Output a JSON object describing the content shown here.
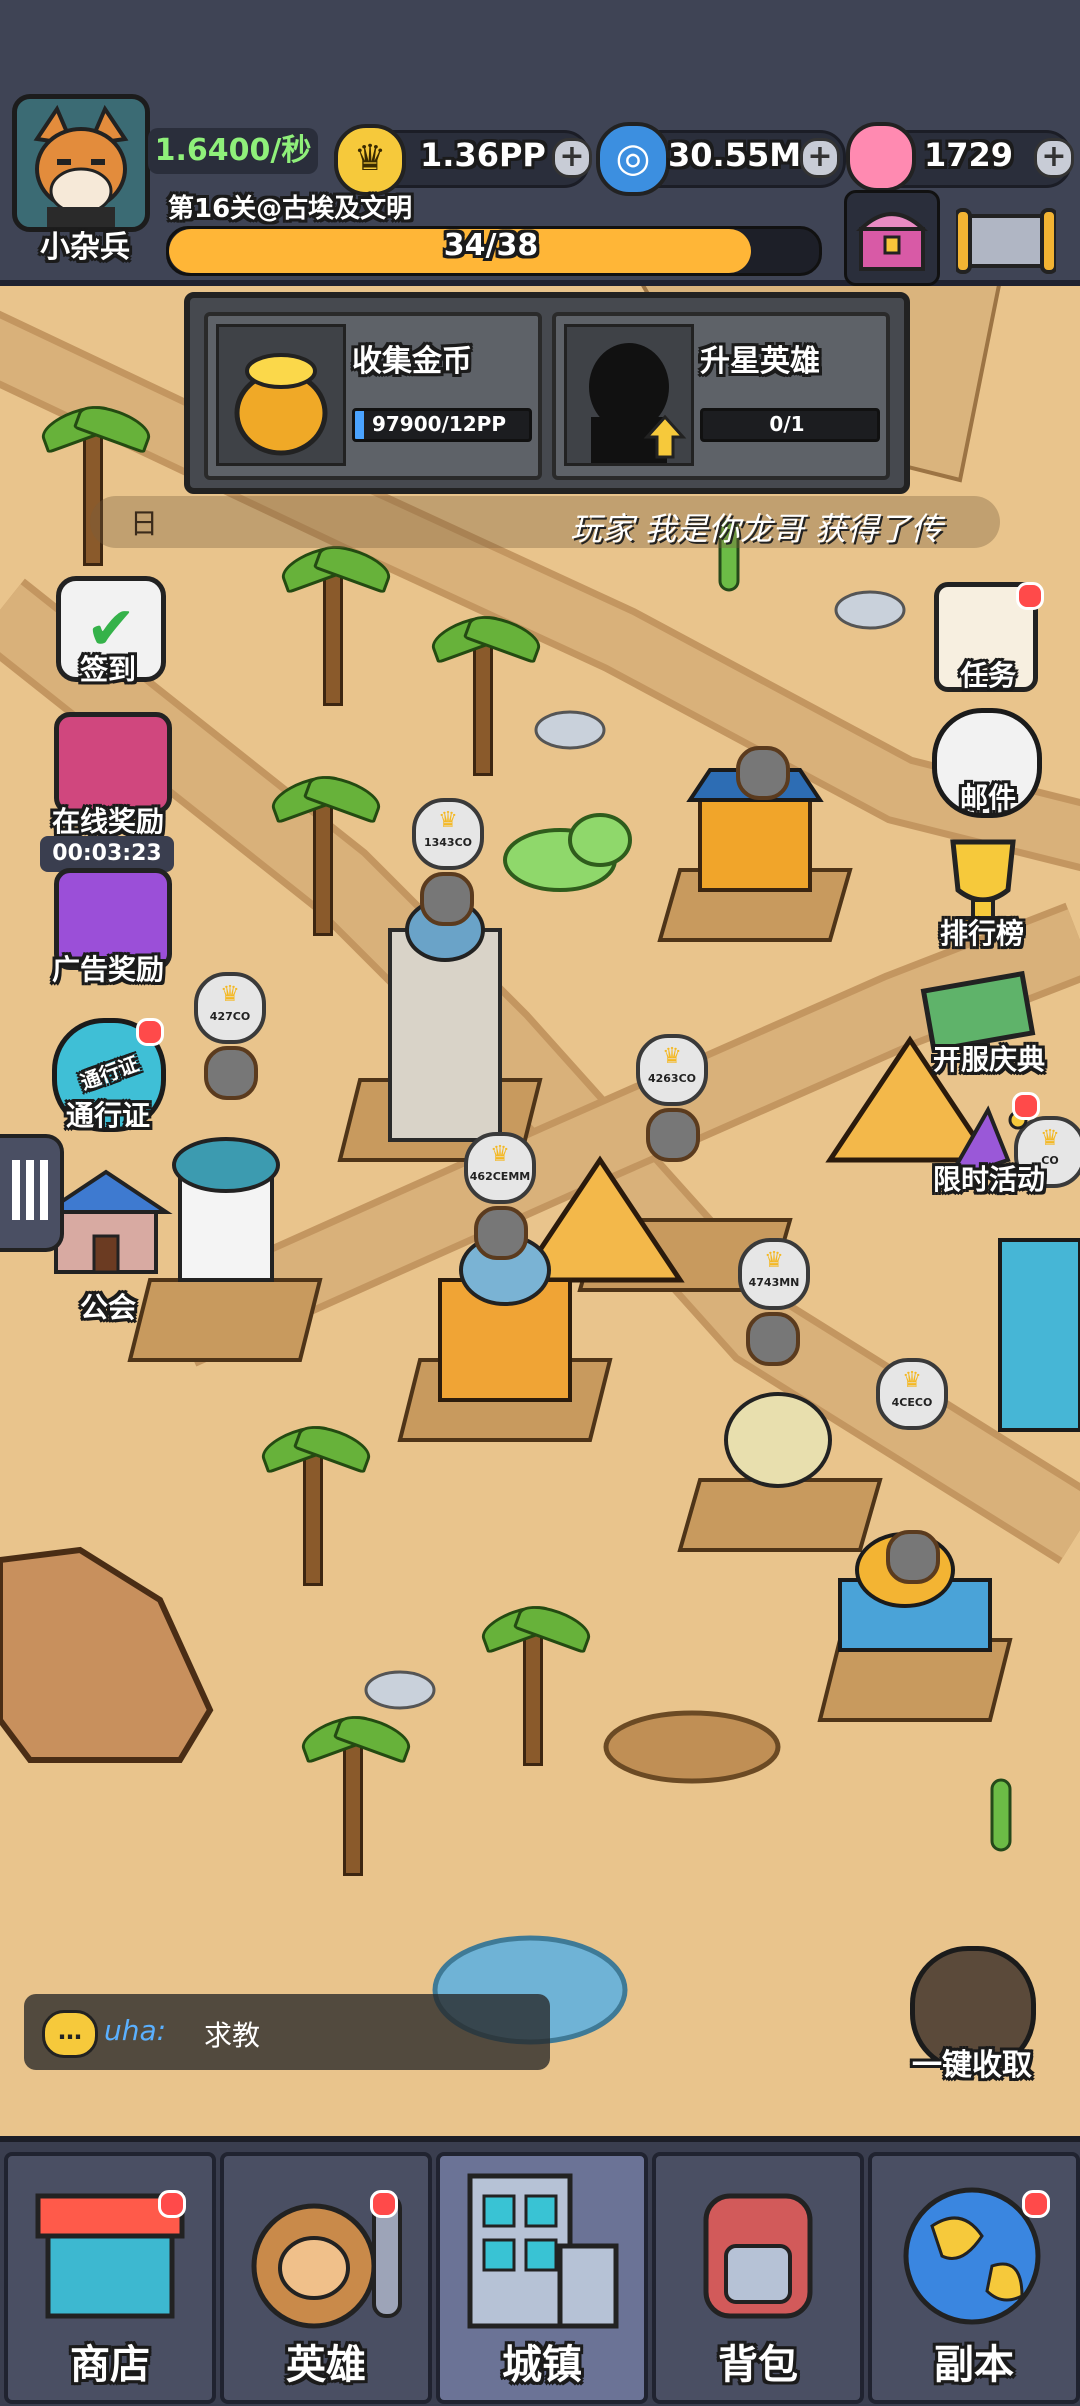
{
  "player": {
    "name": "小杂兵",
    "income_rate": "1.6400/秒",
    "stage_title": "第16关@古埃及文明",
    "stage_progress_text": "34/38",
    "stage_progress_fraction": 0.895
  },
  "resources": {
    "crowns": "1.36PP",
    "gems": "30.55M",
    "candy": "1729"
  },
  "quests": [
    {
      "title": "收集金币",
      "progress_text": "97900/12PP",
      "progress_fraction": 0.05
    },
    {
      "title": "升星英雄",
      "progress_text": "0/1",
      "progress_fraction": 0.0
    }
  ],
  "marquee": {
    "left_text": "日",
    "message": "玩家 我是你龙哥 获得了传"
  },
  "left_menu": {
    "signin": "签到",
    "online_reward": "在线奖励",
    "online_timer": "00:03:23",
    "ad_reward": "广告奖励",
    "pass_icon_text": "通行证",
    "pass": "通行证",
    "guild": "公会"
  },
  "right_menu": {
    "tasks": "任务",
    "mail": "邮件",
    "leaderboard": "排行榜",
    "server_celebration": "开服庆典",
    "limited_event": "限时活动",
    "collect_all": "一键收取"
  },
  "building_levels": [
    "1343CO",
    "427CO",
    "4263CO",
    "462CEMM",
    "4743MN",
    "4CECO",
    "CO"
  ],
  "chat": {
    "sender": "uha:",
    "message": "求教"
  },
  "bottom_nav": [
    {
      "label": "商店",
      "badge": true
    },
    {
      "label": "英雄",
      "badge": true
    },
    {
      "label": "城镇",
      "badge": false
    },
    {
      "label": "背包",
      "badge": false
    },
    {
      "label": "副本",
      "badge": true
    }
  ],
  "colors": {
    "accent_gold": "#ffb637",
    "bar_bg": "#3f4455",
    "badge_red": "#ff4a4a",
    "sand": "#e9c48c"
  }
}
